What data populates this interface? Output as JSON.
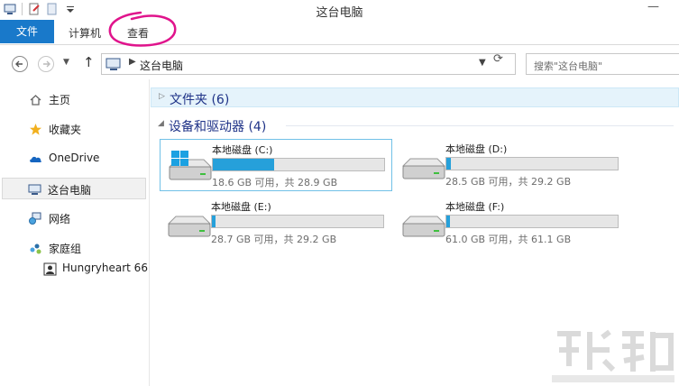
{
  "window": {
    "title": "这台电脑",
    "minimize_glyph": "—"
  },
  "ribbon": {
    "tabs": [
      "文件",
      "计算机",
      "查看"
    ]
  },
  "address": {
    "path": "这台电脑",
    "search_placeholder": "搜索\"这台电脑\""
  },
  "sidebar": {
    "items": [
      {
        "label": "主页",
        "icon": "home-icon"
      },
      {
        "label": "收藏夹",
        "icon": "star-icon"
      },
      {
        "label": "OneDrive",
        "icon": "cloud-icon"
      },
      {
        "label": "这台电脑",
        "icon": "computer-icon"
      },
      {
        "label": "网络",
        "icon": "network-icon"
      },
      {
        "label": "家庭组",
        "icon": "homegroup-icon"
      },
      {
        "label": "Hungryheart 66",
        "icon": "user-icon"
      }
    ]
  },
  "content": {
    "folders_header": "文件夹 (6)",
    "devices_header": "设备和驱动器 (4)",
    "drives": [
      {
        "name": "本地磁盘 (C:)",
        "size_text": "18.6 GB 可用，共 28.9 GB",
        "used_fraction": 0.36,
        "icon": "windows-drive-icon"
      },
      {
        "name": "本地磁盘 (D:)",
        "size_text": "28.5 GB 可用，共 29.2 GB",
        "used_fraction": 0.024,
        "icon": "hard-drive-icon"
      },
      {
        "name": "本地磁盘 (E:)",
        "size_text": "28.7 GB 可用，共 29.2 GB",
        "used_fraction": 0.017,
        "icon": "hard-drive-icon"
      },
      {
        "name": "本地磁盘 (F:)",
        "size_text": "61.0 GB 可用，共 61.1 GB",
        "used_fraction": 0.005,
        "icon": "hard-drive-icon"
      }
    ]
  },
  "colors": {
    "accent": "#1979ca",
    "bar_fill": "#26a0da",
    "group_title": "#1e3287",
    "annotation": "#e0148c"
  }
}
